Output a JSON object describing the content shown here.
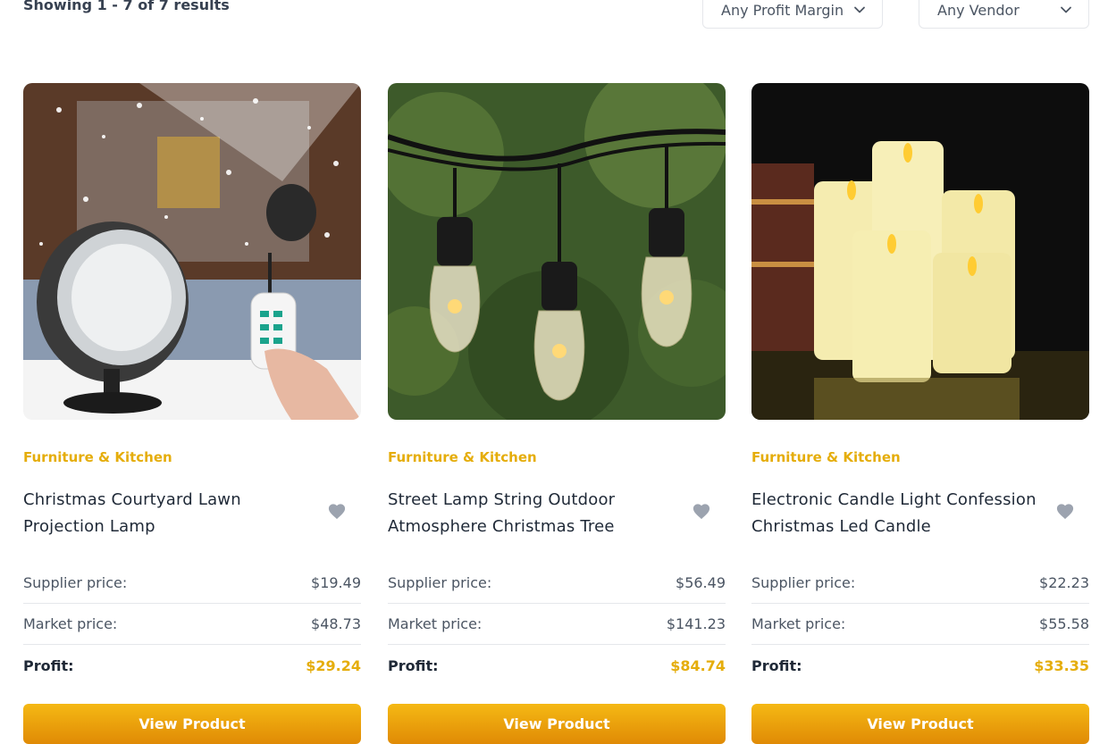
{
  "toolbar": {
    "results_text": "Showing 1 - 7 of 7 results",
    "profit_filter": "Any Profit Margin",
    "vendor_filter": "Any Vendor"
  },
  "labels": {
    "supplier": "Supplier price:",
    "market": "Market price:",
    "profit": "Profit:",
    "view": "View Product"
  },
  "products": [
    {
      "category": "Furniture & Kitchen",
      "title": "Christmas Courtyard Lawn Projection Lamp",
      "supplier_price": "$19.49",
      "market_price": "$48.73",
      "profit": "$29.24",
      "image": "snowflake-projector-lamp-photo"
    },
    {
      "category": "Furniture & Kitchen",
      "title": "Street Lamp String Outdoor Atmosphere Christmas Tree",
      "supplier_price": "$56.49",
      "market_price": "$141.23",
      "profit": "$84.74",
      "image": "string-lights-bulbs-photo"
    },
    {
      "category": "Furniture & Kitchen",
      "title": "Electronic Candle Light Confession Christmas Led Candle",
      "supplier_price": "$22.23",
      "market_price": "$55.58",
      "profit": "$33.35",
      "image": "led-candles-photo"
    }
  ],
  "colors": {
    "accent": "#e5ad0b",
    "button_start": "#f5b914",
    "button_end": "#e08a05"
  }
}
